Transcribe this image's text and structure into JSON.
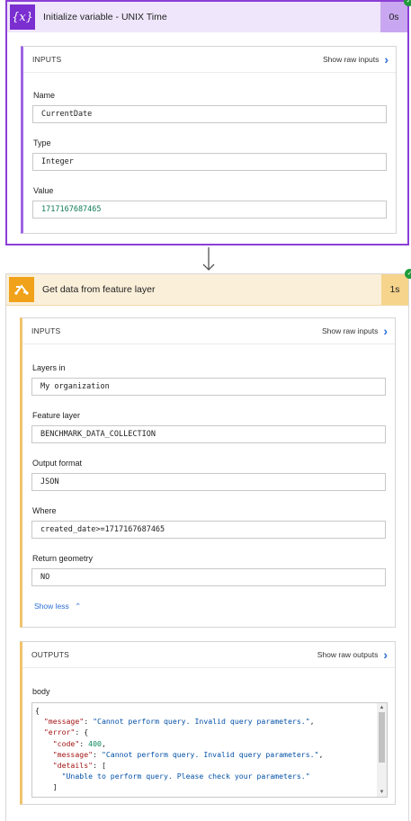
{
  "step1": {
    "icon": "variable-icon",
    "icon_text": "{x}",
    "title": "Initialize variable - UNIX Time",
    "duration": "0s",
    "inputs": {
      "title": "INPUTS",
      "raw_label": "Show raw inputs",
      "fields": [
        {
          "label": "Name",
          "value": "CurrentDate"
        },
        {
          "label": "Type",
          "value": "Integer"
        },
        {
          "label": "Value",
          "value": "1717167687465"
        }
      ]
    }
  },
  "step2": {
    "icon": "feature-layer-icon",
    "title": "Get data from feature layer",
    "duration": "1s",
    "inputs": {
      "title": "INPUTS",
      "raw_label": "Show raw inputs",
      "fields": [
        {
          "label": "Layers in",
          "value": "My organization"
        },
        {
          "label": "Feature layer",
          "value": "BENCHMARK_DATA_COLLECTION"
        },
        {
          "label": "Output format",
          "value": "JSON"
        },
        {
          "label": "Where",
          "value": "created_date>=1717167687465"
        },
        {
          "label": "Return geometry",
          "value": "NO"
        }
      ],
      "show_less": "Show less"
    },
    "outputs": {
      "title": "OUTPUTS",
      "raw_label": "Show raw outputs",
      "body_label": "body",
      "body_lines": [
        "{",
        "  \"message\": \"Cannot perform query. Invalid query parameters.\",",
        "  \"error\": {",
        "    \"code\": 400,",
        "    \"message\": \"Cannot perform query. Invalid query parameters.\",",
        "    \"details\": [",
        "      \"Unable to perform query. Please check your parameters.\"",
        "    ]"
      ]
    }
  },
  "colors": {
    "variable_accent": "#8b3fd6",
    "feature_accent": "#f0a21a",
    "link": "#2b6fd6",
    "success": "#1f9b3a"
  }
}
